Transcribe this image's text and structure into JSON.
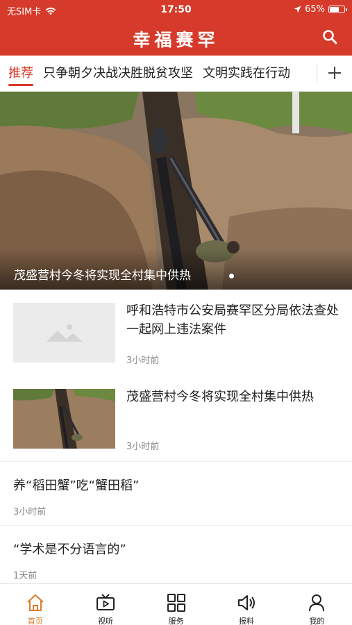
{
  "status_bar": {
    "carrier": "无SIM卡",
    "time": "17:50",
    "battery": "65%",
    "battery_level": 0.65,
    "icons": [
      "wifi-icon",
      "location-arrow-icon",
      "battery-icon"
    ]
  },
  "header": {
    "title": "幸福赛罕",
    "search_icon": "search-icon",
    "accent_color": "#d63a2a"
  },
  "tabs": {
    "items": [
      {
        "label": "推荐",
        "active": true
      },
      {
        "label": "只争朝夕决战决胜脱贫攻坚",
        "active": false
      },
      {
        "label": "文明实践在行动",
        "active": false
      }
    ],
    "add_icon": "plus-icon"
  },
  "hero": {
    "caption": "茂盛营村今冬将实现全村集中供热"
  },
  "news": [
    {
      "title": "呼和浩特市公安局赛罕区分局依法查处一起网上违法案件",
      "time": "3小时前",
      "thumb": "image-placeholder-icon"
    },
    {
      "title": "茂盛营村今冬将实现全村集中供热",
      "time": "3小时前",
      "thumb": "pipeline-photo"
    },
    {
      "title": "养“稻田蟹”吃“蟹田稻”",
      "time": "3小时前"
    },
    {
      "title": "“学术是不分语言的”",
      "time": "1天前"
    }
  ],
  "bottom_nav": {
    "items": [
      {
        "label": "首页",
        "icon": "home-icon",
        "active": true
      },
      {
        "label": "视听",
        "icon": "tv-video-icon",
        "active": false
      },
      {
        "label": "服务",
        "icon": "grid-icon",
        "active": false
      },
      {
        "label": "报料",
        "icon": "speaker-icon",
        "active": false
      },
      {
        "label": "我的",
        "icon": "user-icon",
        "active": false
      }
    ],
    "active_color": "#e07a2a"
  }
}
